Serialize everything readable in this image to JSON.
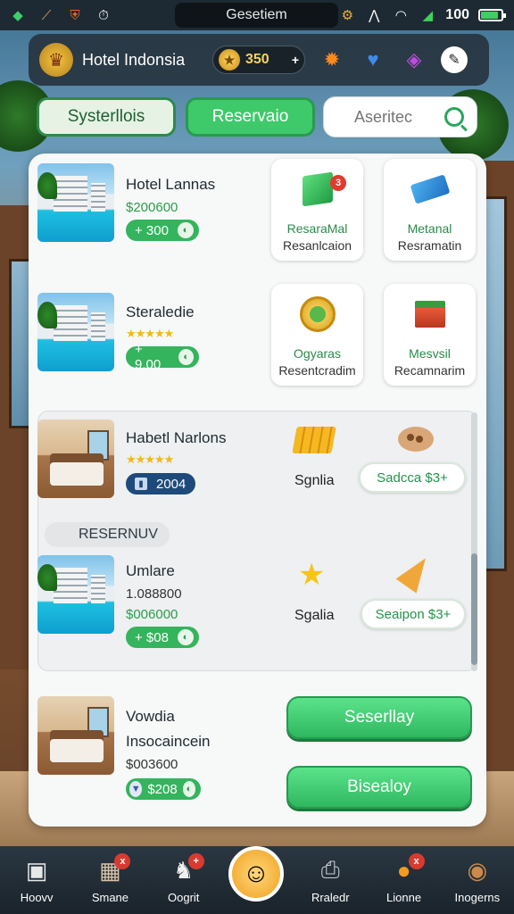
{
  "status_bar": {
    "title": "Gesetiem",
    "battery": "100",
    "battery_level": 0.85
  },
  "header": {
    "title": "Hotel Indonsia",
    "coins": "350",
    "coins_plus": "+"
  },
  "tabs": {
    "systems": "Systerllois",
    "reservation": "Reservaio"
  },
  "search": {
    "placeholder": "Aseritec"
  },
  "hotels": [
    {
      "name": "Hotel Lannas",
      "price": "$200600",
      "pill": "+ 300",
      "thumb": "pool"
    },
    {
      "name": "Steraledie",
      "stars": "★★★★★",
      "pill": "+ 9.00",
      "thumb": "pool"
    },
    {
      "name": "Habetl Narlons",
      "stars": "★★★★★",
      "pill": "2004",
      "thumb": "room"
    },
    {
      "name": "Umlare",
      "sub": "1.088800",
      "price": "$006000",
      "pill": "+ $08",
      "thumb": "pool"
    },
    {
      "name": "Vowdia",
      "sub": "Insocaincein",
      "price": "$003600",
      "pill": "$208",
      "thumb": "room"
    }
  ],
  "cards": [
    {
      "icon": "green-cube-icon",
      "title": "ResaraMal",
      "sub": "Resanlcaion",
      "badge": "3"
    },
    {
      "icon": "blue-mat-icon",
      "title": "Metanal",
      "sub": "Resramatin"
    },
    {
      "icon": "gold-medal-icon",
      "title": "Ogyaras",
      "sub": "Resentcradim"
    },
    {
      "icon": "red-box-icon",
      "title": "Mesvsil",
      "sub": "Recamnarim"
    }
  ],
  "group": {
    "section_label": "RESERNUV",
    "rows": [
      {
        "icon": "gold-bars-icon",
        "label": "Sgnlia",
        "button_icon": "palette-icon",
        "button": "Sadcca $3+"
      },
      {
        "icon": "star-icon",
        "label": "Sgalia",
        "button_icon": "cone-icon",
        "button": "Seaipon $3+"
      }
    ]
  },
  "actions": {
    "primary": "Seserllay",
    "secondary": "Bisealoy"
  },
  "bottom_nav": [
    {
      "label": "Hoovv",
      "icon": "box-icon"
    },
    {
      "label": "Smane",
      "icon": "cube-icon",
      "badge": "x"
    },
    {
      "label": "Oogrit",
      "icon": "robot-icon",
      "badge": "+"
    },
    {
      "label": "",
      "icon": "smiley-flower-icon"
    },
    {
      "label": "Rraledr",
      "icon": "printer-icon"
    },
    {
      "label": "Lionne",
      "icon": "orange-icon",
      "badge": "x"
    },
    {
      "label": "Inogerns",
      "icon": "food-icon"
    }
  ],
  "colors": {
    "accent_green": "#3ec96a",
    "price_green": "#2aa04a",
    "header_bg": "#26303a",
    "coin_gold": "#f6d35a"
  }
}
